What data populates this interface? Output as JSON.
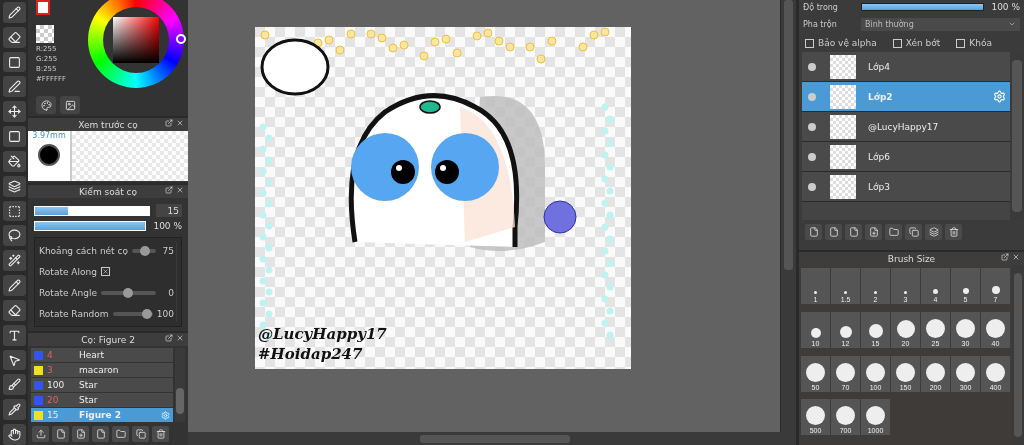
{
  "color_panel": {
    "r": "R:255",
    "g": "G:255",
    "b": "B:255",
    "hex": "#FFFFFF"
  },
  "brush_preview": {
    "title": "Xem trước cọ",
    "size": "3.97mm"
  },
  "brush_control": {
    "title": "Kiểm soát cọ",
    "size": {
      "level": 0.29,
      "value": "15"
    },
    "opacity": {
      "level": 1,
      "value": "100 %"
    },
    "settings": [
      {
        "kind": "slider",
        "label": "Khoảng cách nét cọ",
        "level": 0.55,
        "value": "75"
      },
      {
        "kind": "checkbox",
        "label": "Rotate Along",
        "checked": true
      },
      {
        "kind": "slider",
        "label": "Rotate Angle",
        "level": 0.5,
        "value": "0"
      },
      {
        "kind": "slider",
        "label": "Rotate Random",
        "level": 0.85,
        "value": "100"
      }
    ]
  },
  "brushes": {
    "title": "Cọ: Figure 2",
    "items": [
      {
        "color": "#3355ee",
        "size": "4",
        "name": "Heart",
        "custom_size": true,
        "selected": false
      },
      {
        "color": "#f0e020",
        "size": "3",
        "name": "macaron",
        "custom_size": true,
        "selected": false
      },
      {
        "color": "#3355ee",
        "size": "100",
        "name": "Star",
        "custom_size": false,
        "selected": false
      },
      {
        "color": "#3355ee",
        "size": "20",
        "name": "Star",
        "custom_size": true,
        "selected": false
      },
      {
        "color": "#f0e020",
        "size": "15",
        "name": "Figure 2",
        "custom_size": true,
        "selected": true
      }
    ]
  },
  "canvas": {
    "signature": [
      "@LucyHappy17",
      "#Hoidap247"
    ]
  },
  "layer_panel": {
    "opacity": {
      "label": "Độ trong",
      "level": 1,
      "value": "100 %"
    },
    "blend": {
      "label": "Pha trộn",
      "value": "Bình thường"
    },
    "options": [
      {
        "label": "Bảo vệ alpha",
        "checked": false
      },
      {
        "label": "Xén bớt",
        "checked": false
      },
      {
        "label": "Khóa",
        "checked": false
      }
    ],
    "layers": [
      {
        "name": "Lớp4",
        "selected": false
      },
      {
        "name": "Lớp2",
        "selected": true
      },
      {
        "name": "@LucyHappy17",
        "selected": false
      },
      {
        "name": "Lớp6",
        "selected": false
      },
      {
        "name": "Lớp3",
        "selected": false
      }
    ]
  },
  "brush_size": {
    "title": "Brush Size",
    "sizes": [
      "1",
      "1.5",
      "2",
      "3",
      "4",
      "5",
      "7",
      "10",
      "12",
      "15",
      "20",
      "25",
      "30",
      "40",
      "50",
      "70",
      "100",
      "150",
      "200",
      "300",
      "400",
      "500",
      "700",
      "1000"
    ]
  }
}
